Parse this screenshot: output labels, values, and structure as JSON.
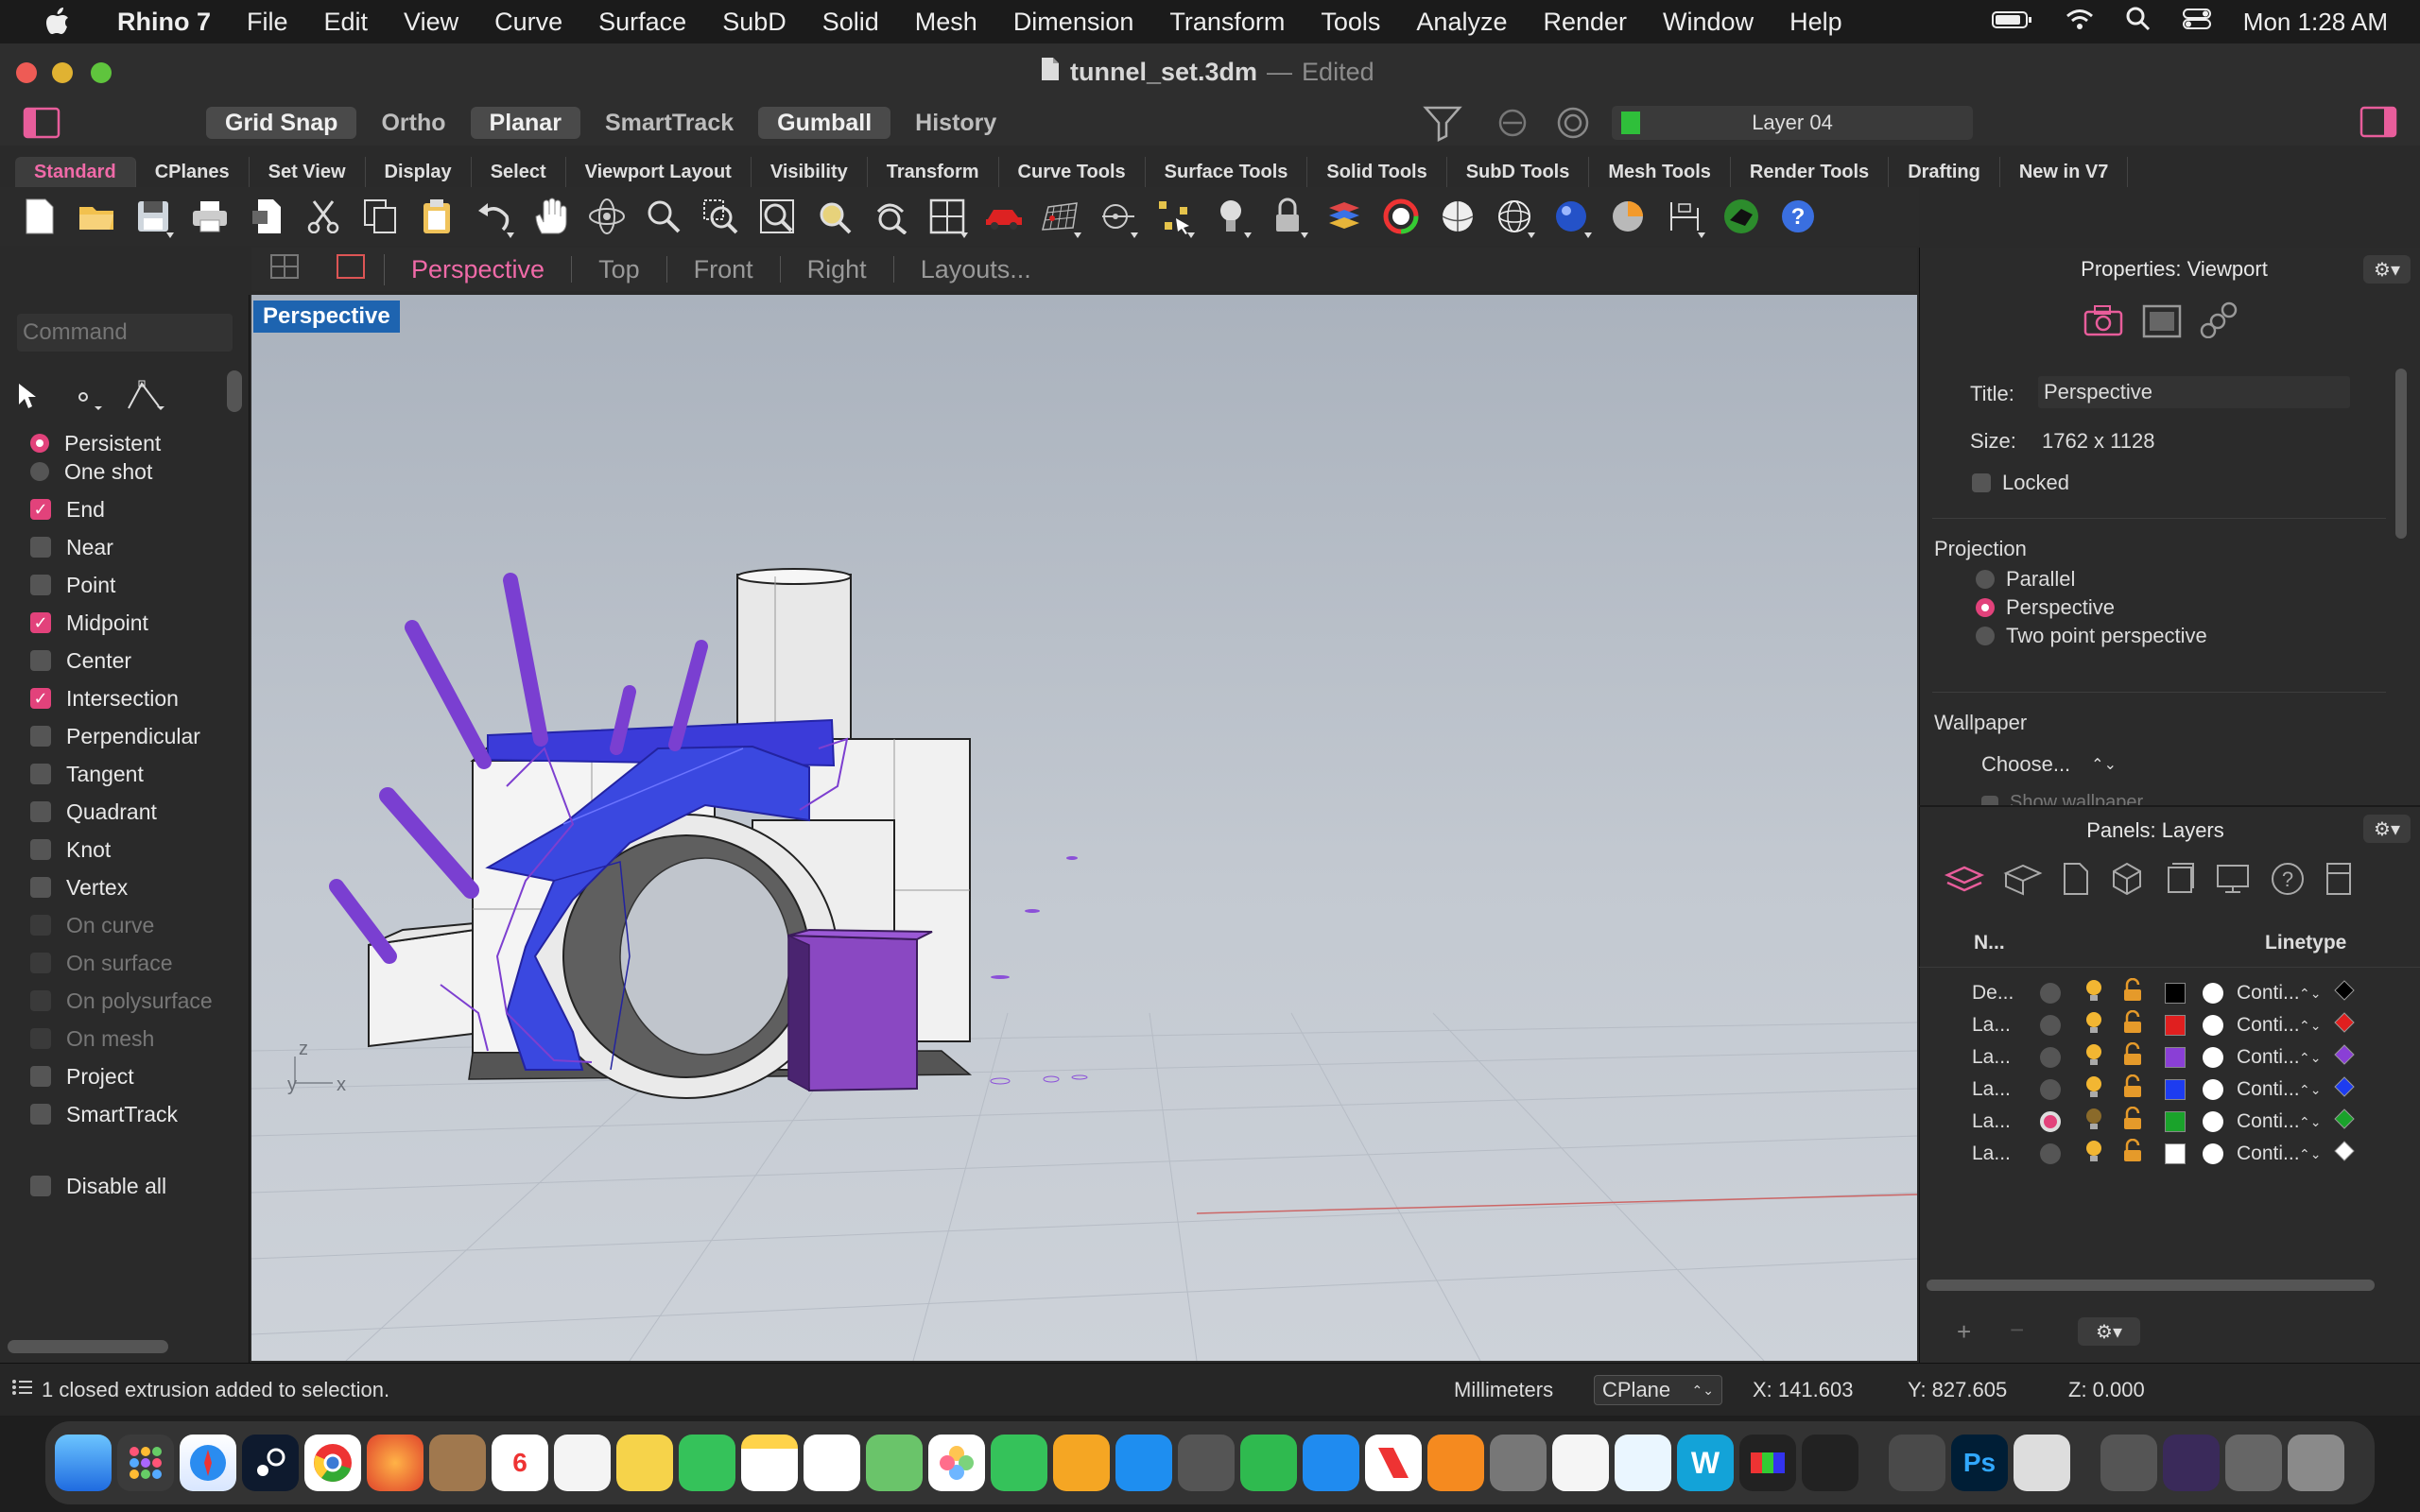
{
  "menubar": {
    "app": "Rhino 7",
    "items": [
      "File",
      "Edit",
      "View",
      "Curve",
      "Surface",
      "SubD",
      "Solid",
      "Mesh",
      "Dimension",
      "Transform",
      "Tools",
      "Analyze",
      "Render",
      "Window",
      "Help"
    ],
    "clock": "Mon  1:28 AM"
  },
  "window": {
    "file": "tunnel_set.3dm",
    "sep": "—",
    "status": "Edited"
  },
  "options": {
    "grid_snap": "Grid Snap",
    "ortho": "Ortho",
    "planar": "Planar",
    "smarttrack": "SmartTrack",
    "gumball": "Gumball",
    "history": "History",
    "layer": "Layer 04",
    "layer_color": "#2fbf3a"
  },
  "tabs": [
    "Standard",
    "CPlanes",
    "Set View",
    "Display",
    "Select",
    "Viewport Layout",
    "Visibility",
    "Transform",
    "Curve Tools",
    "Surface Tools",
    "Solid Tools",
    "SubD Tools",
    "Mesh Tools",
    "Render Tools",
    "Drafting",
    "New in V7"
  ],
  "viewport_tabs": {
    "perspective": "Perspective",
    "top": "Top",
    "front": "Front",
    "right": "Right",
    "layouts": "Layouts..."
  },
  "viewport_label": "Perspective",
  "command": {
    "placeholder": "Command"
  },
  "osnap": {
    "persistent": "Persistent",
    "one_shot": "One shot",
    "items": [
      {
        "label": "End",
        "checked": true,
        "disabled": false
      },
      {
        "label": "Near",
        "checked": false,
        "disabled": false
      },
      {
        "label": "Point",
        "checked": false,
        "disabled": false
      },
      {
        "label": "Midpoint",
        "checked": true,
        "disabled": false
      },
      {
        "label": "Center",
        "checked": false,
        "disabled": false
      },
      {
        "label": "Intersection",
        "checked": true,
        "disabled": false
      },
      {
        "label": "Perpendicular",
        "checked": false,
        "disabled": false
      },
      {
        "label": "Tangent",
        "checked": false,
        "disabled": false
      },
      {
        "label": "Quadrant",
        "checked": false,
        "disabled": false
      },
      {
        "label": "Knot",
        "checked": false,
        "disabled": false
      },
      {
        "label": "Vertex",
        "checked": false,
        "disabled": false
      },
      {
        "label": "On curve",
        "checked": false,
        "disabled": true
      },
      {
        "label": "On surface",
        "checked": false,
        "disabled": true
      },
      {
        "label": "On polysurface",
        "checked": false,
        "disabled": true
      },
      {
        "label": "On mesh",
        "checked": false,
        "disabled": true
      },
      {
        "label": "Project",
        "checked": false,
        "disabled": false
      },
      {
        "label": "SmartTrack",
        "checked": false,
        "disabled": false
      }
    ],
    "disable_all": "Disable all"
  },
  "properties": {
    "header": "Properties: Viewport",
    "title_label": "Title:",
    "title_value": "Perspective",
    "size_label": "Size:",
    "size_value": "1762 x 1128",
    "locked": "Locked",
    "projection": "Projection",
    "parallel": "Parallel",
    "perspective": "Perspective",
    "two_point": "Two point perspective",
    "wallpaper": "Wallpaper",
    "choose": "Choose...",
    "show_wallpaper": "Show wallpaper"
  },
  "layers": {
    "header": "Panels: Layers",
    "col_name": "N...",
    "col_linetype": "Linetype",
    "rows": [
      {
        "name": "De...",
        "color": "#000000",
        "linetype": "Conti...",
        "current": false
      },
      {
        "name": "La...",
        "color": "#e01f1f",
        "linetype": "Conti...",
        "current": false
      },
      {
        "name": "La...",
        "color": "#8a3fd6",
        "linetype": "Conti...",
        "current": false
      },
      {
        "name": "La...",
        "color": "#1d3cf0",
        "linetype": "Conti...",
        "current": false
      },
      {
        "name": "La...",
        "color": "#1aa32b",
        "linetype": "Conti...",
        "current": true
      },
      {
        "name": "La...",
        "color": "#ffffff",
        "linetype": "Conti...",
        "current": false
      }
    ],
    "add": "+",
    "remove": "−"
  },
  "status": {
    "message": "1 closed extrusion added to selection.",
    "units": "Millimeters",
    "cplane": "CPlane",
    "x": "X: 141.603",
    "y": "Y: 827.605",
    "z": "Z: 0.000"
  },
  "axes": {
    "x": "x",
    "y": "y",
    "z": "z"
  }
}
